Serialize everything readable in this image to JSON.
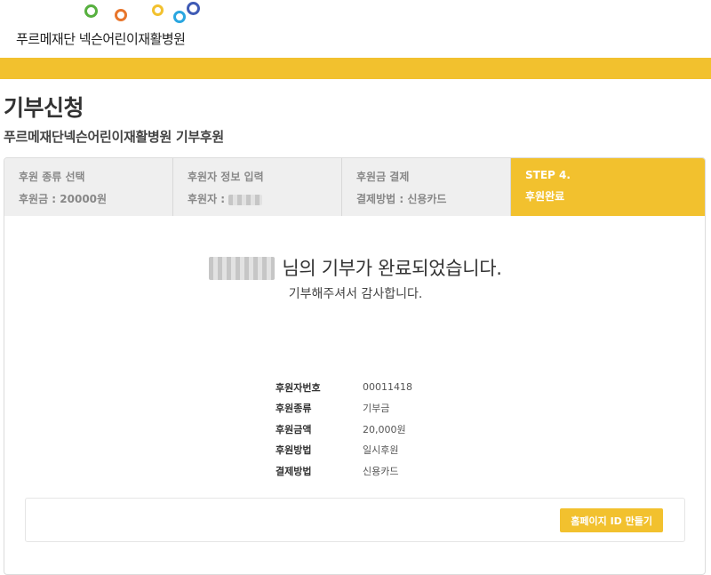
{
  "logo": {
    "text": "푸르메재단 넥슨어린이재활병원",
    "ring_colors": [
      "#57b03f",
      "#e8762c",
      "#f2c12e",
      "#2aa6e0",
      "#3f5bb5"
    ]
  },
  "page": {
    "title": "기부신청",
    "subtitle": "푸르메재단넥슨어린이재활병원 기부후원"
  },
  "steps": [
    {
      "name": "후원 종류 선택",
      "value": "후원금 : 20000원"
    },
    {
      "name": "후원자 정보 입력",
      "value": "후원자 :"
    },
    {
      "name": "후원금 결제",
      "value": "결제방법 : 신용카드"
    },
    {
      "name": "STEP 4.",
      "value": "후원완료"
    }
  ],
  "completion": {
    "message": "님의 기부가 완료되었습니다.",
    "thanks": "기부해주셔서 감사합니다."
  },
  "donation_info": [
    {
      "label": "후원자번호",
      "value": "00011418"
    },
    {
      "label": "후원종류",
      "value": "기부금"
    },
    {
      "label": "후원금액",
      "value": "20,000원"
    },
    {
      "label": "후원방법",
      "value": "일시후원"
    },
    {
      "label": "결제방법",
      "value": "신용카드"
    }
  ],
  "actions": {
    "make_id_label": "홈페이지 ID 만들기"
  },
  "colors": {
    "accent": "#f2c12e",
    "step_inactive": "#efefef"
  }
}
